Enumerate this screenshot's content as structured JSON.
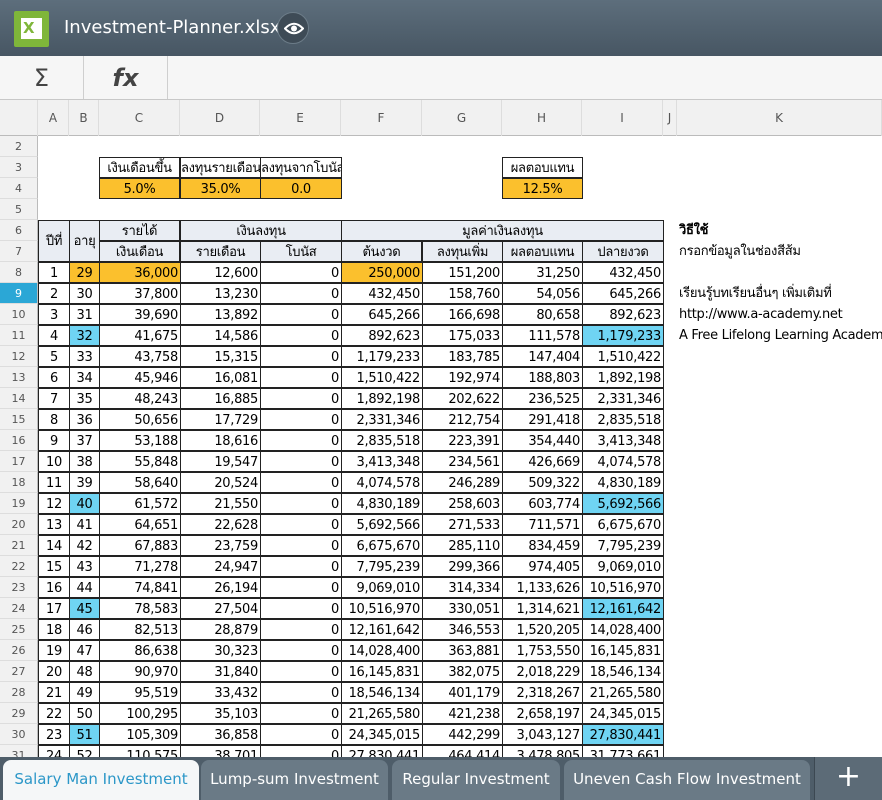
{
  "app": {
    "title": "Investment-Planner.xlsx",
    "icon_letter": "X"
  },
  "toolbar": {
    "sum_label": "Σ",
    "fx_label": "fx"
  },
  "columns": [
    "A",
    "B",
    "C",
    "D",
    "E",
    "F",
    "G",
    "H",
    "I",
    "J",
    "K"
  ],
  "rows": [
    2,
    3,
    4,
    5,
    6,
    7,
    8,
    9,
    10,
    11,
    12,
    13,
    14,
    15,
    16,
    17,
    18,
    19,
    20,
    21,
    22,
    23,
    24,
    25,
    26,
    27,
    28,
    29,
    30,
    31
  ],
  "selected_row": 9,
  "inputs": {
    "salary_raise_label": "เงินเดือนขึ้น",
    "salary_raise": "5.0%",
    "monthly_invest_label": "ลงทุนรายเดือน",
    "monthly_invest": "35.0%",
    "bonus_invest_label": "ลงทุนจากโบนัส",
    "bonus_invest": "0.0",
    "return_label": "ผลตอบแทน",
    "return": "12.5%"
  },
  "headers": {
    "year": "ปีที่",
    "age": "อายุ",
    "income": "รายได้",
    "salary": "เงินเดือน",
    "investment": "เงินลงทุน",
    "monthly": "รายเดือน",
    "bonus": "โบนัส",
    "value": "มูลค่าเงินลงทุน",
    "begin": "ต้นงวด",
    "add": "ลงทุนเพิ่ม",
    "ret": "ผลตอบแทน",
    "end": "ปลายงวด"
  },
  "notes": {
    "howto_title": "วิธีใช้",
    "howto_text": "กรอกข้อมูลในช่องสีส้ม",
    "more_text": "เรียนรู้บทเรียนอื่นๆ เพิ่มเติมที่",
    "url": "http://www.a-academy.net",
    "tagline": "A Free Lifelong Learning Academy"
  },
  "table": [
    {
      "y": "1",
      "age": "29",
      "sal": "36,000",
      "mon": "12,600",
      "bon": "0",
      "beg": "250,000",
      "add": "151,200",
      "ret": "31,250",
      "end": "432,450"
    },
    {
      "y": "2",
      "age": "30",
      "sal": "37,800",
      "mon": "13,230",
      "bon": "0",
      "beg": "432,450",
      "add": "158,760",
      "ret": "54,056",
      "end": "645,266"
    },
    {
      "y": "3",
      "age": "31",
      "sal": "39,690",
      "mon": "13,892",
      "bon": "0",
      "beg": "645,266",
      "add": "166,698",
      "ret": "80,658",
      "end": "892,623"
    },
    {
      "y": "4",
      "age": "32",
      "sal": "41,675",
      "mon": "14,586",
      "bon": "0",
      "beg": "892,623",
      "add": "175,033",
      "ret": "111,578",
      "end": "1,179,233"
    },
    {
      "y": "5",
      "age": "33",
      "sal": "43,758",
      "mon": "15,315",
      "bon": "0",
      "beg": "1,179,233",
      "add": "183,785",
      "ret": "147,404",
      "end": "1,510,422"
    },
    {
      "y": "6",
      "age": "34",
      "sal": "45,946",
      "mon": "16,081",
      "bon": "0",
      "beg": "1,510,422",
      "add": "192,974",
      "ret": "188,803",
      "end": "1,892,198"
    },
    {
      "y": "7",
      "age": "35",
      "sal": "48,243",
      "mon": "16,885",
      "bon": "0",
      "beg": "1,892,198",
      "add": "202,622",
      "ret": "236,525",
      "end": "2,331,346"
    },
    {
      "y": "8",
      "age": "36",
      "sal": "50,656",
      "mon": "17,729",
      "bon": "0",
      "beg": "2,331,346",
      "add": "212,754",
      "ret": "291,418",
      "end": "2,835,518"
    },
    {
      "y": "9",
      "age": "37",
      "sal": "53,188",
      "mon": "18,616",
      "bon": "0",
      "beg": "2,835,518",
      "add": "223,391",
      "ret": "354,440",
      "end": "3,413,348"
    },
    {
      "y": "10",
      "age": "38",
      "sal": "55,848",
      "mon": "19,547",
      "bon": "0",
      "beg": "3,413,348",
      "add": "234,561",
      "ret": "426,669",
      "end": "4,074,578"
    },
    {
      "y": "11",
      "age": "39",
      "sal": "58,640",
      "mon": "20,524",
      "bon": "0",
      "beg": "4,074,578",
      "add": "246,289",
      "ret": "509,322",
      "end": "4,830,189"
    },
    {
      "y": "12",
      "age": "40",
      "sal": "61,572",
      "mon": "21,550",
      "bon": "0",
      "beg": "4,830,189",
      "add": "258,603",
      "ret": "603,774",
      "end": "5,692,566"
    },
    {
      "y": "13",
      "age": "41",
      "sal": "64,651",
      "mon": "22,628",
      "bon": "0",
      "beg": "5,692,566",
      "add": "271,533",
      "ret": "711,571",
      "end": "6,675,670"
    },
    {
      "y": "14",
      "age": "42",
      "sal": "67,883",
      "mon": "23,759",
      "bon": "0",
      "beg": "6,675,670",
      "add": "285,110",
      "ret": "834,459",
      "end": "7,795,239"
    },
    {
      "y": "15",
      "age": "43",
      "sal": "71,278",
      "mon": "24,947",
      "bon": "0",
      "beg": "7,795,239",
      "add": "299,366",
      "ret": "974,405",
      "end": "9,069,010"
    },
    {
      "y": "16",
      "age": "44",
      "sal": "74,841",
      "mon": "26,194",
      "bon": "0",
      "beg": "9,069,010",
      "add": "314,334",
      "ret": "1,133,626",
      "end": "10,516,970"
    },
    {
      "y": "17",
      "age": "45",
      "sal": "78,583",
      "mon": "27,504",
      "bon": "0",
      "beg": "10,516,970",
      "add": "330,051",
      "ret": "1,314,621",
      "end": "12,161,642"
    },
    {
      "y": "18",
      "age": "46",
      "sal": "82,513",
      "mon": "28,879",
      "bon": "0",
      "beg": "12,161,642",
      "add": "346,553",
      "ret": "1,520,205",
      "end": "14,028,400"
    },
    {
      "y": "19",
      "age": "47",
      "sal": "86,638",
      "mon": "30,323",
      "bon": "0",
      "beg": "14,028,400",
      "add": "363,881",
      "ret": "1,753,550",
      "end": "16,145,831"
    },
    {
      "y": "20",
      "age": "48",
      "sal": "90,970",
      "mon": "31,840",
      "bon": "0",
      "beg": "16,145,831",
      "add": "382,075",
      "ret": "2,018,229",
      "end": "18,546,134"
    },
    {
      "y": "21",
      "age": "49",
      "sal": "95,519",
      "mon": "33,432",
      "bon": "0",
      "beg": "18,546,134",
      "add": "401,179",
      "ret": "2,318,267",
      "end": "21,265,580"
    },
    {
      "y": "22",
      "age": "50",
      "sal": "100,295",
      "mon": "35,103",
      "bon": "0",
      "beg": "21,265,580",
      "add": "421,238",
      "ret": "2,658,197",
      "end": "24,345,015"
    },
    {
      "y": "23",
      "age": "51",
      "sal": "105,309",
      "mon": "36,858",
      "bon": "0",
      "beg": "24,345,015",
      "add": "442,299",
      "ret": "3,043,127",
      "end": "27,830,441"
    },
    {
      "y": "24",
      "age": "52",
      "sal": "110,575",
      "mon": "38,701",
      "bon": "0",
      "beg": "27,830,441",
      "add": "464,414",
      "ret": "3,478,805",
      "end": "31,773,661"
    }
  ],
  "highlight_ages": [
    "32",
    "40",
    "45",
    "51"
  ],
  "highlight_end_rows": [
    4,
    12,
    17,
    23
  ],
  "tabs": [
    "Salary Man Investment",
    "Lump-sum Investment",
    "Regular Investment",
    "Uneven Cash Flow Investment"
  ],
  "active_tab": 0,
  "add_tab_label": "+",
  "colors": {
    "topbar": "#4f5f6c",
    "input": "#fbc02d",
    "highlight": "#6fd4f3",
    "selected": "#2ba7d6"
  }
}
